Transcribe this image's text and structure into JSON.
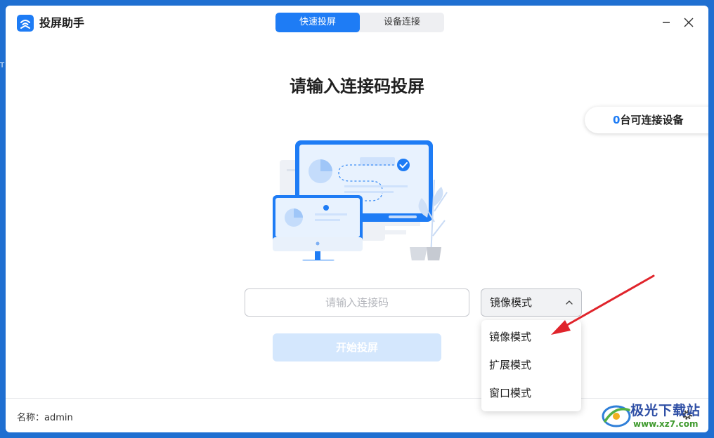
{
  "app": {
    "title": "投屏助手"
  },
  "tabs": [
    {
      "label": "快速投屏",
      "active": true
    },
    {
      "label": "设备连接",
      "active": false
    }
  ],
  "window_controls": {
    "minimize_icon": "minimize-icon",
    "close_icon": "close-icon"
  },
  "main": {
    "heading": "请输入连接码投屏",
    "devices": {
      "count": "0",
      "label": "台可连接设备"
    },
    "code_input": {
      "value": "",
      "placeholder": "请输入连接码"
    },
    "mode_select": {
      "selected": "镜像模式",
      "expanded": true
    },
    "mode_options": [
      "镜像模式",
      "扩展模式",
      "窗口模式"
    ],
    "start_button": "开始投屏"
  },
  "footer": {
    "name_label": "名称：admin"
  },
  "watermark": {
    "title": "极光下载站",
    "url": "www.xz7.com"
  },
  "desktop_edge_text": "T",
  "colors": {
    "accent": "#1e7cf5",
    "button_disabled": "#d4e7fd",
    "annotation_arrow": "#e0242b"
  }
}
